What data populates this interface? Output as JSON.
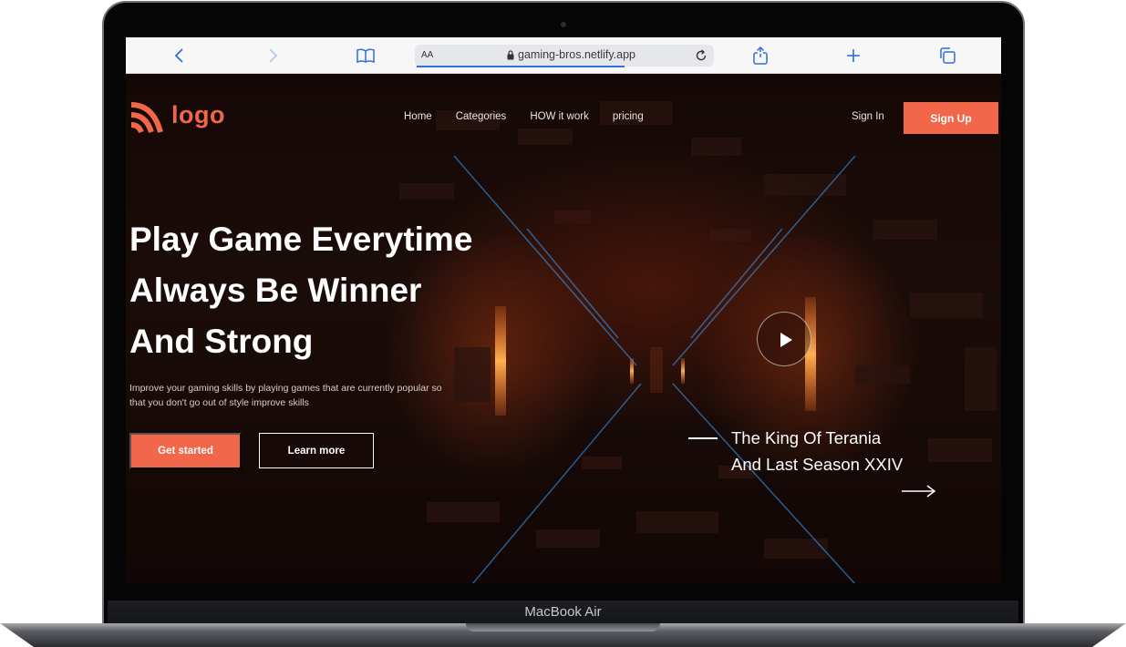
{
  "device": {
    "label": "MacBook Air"
  },
  "browser": {
    "text_size_label": "AA",
    "url": "gaming-bros.netlify.app",
    "icons": [
      "back-icon",
      "forward-icon",
      "bookmarks-icon",
      "lock-icon",
      "reload-icon",
      "share-icon",
      "new-tab-icon",
      "tabs-icon"
    ]
  },
  "site": {
    "logo_text": "logo",
    "nav": {
      "home": "Home",
      "categories": "Categories",
      "how_it_work": "HOW it work",
      "pricing": "pricing"
    },
    "sign_in": "Sign In",
    "sign_up": "Sign Up",
    "hero": {
      "line1": "Play Game Everytime",
      "line2": "Always Be Winner",
      "line3": "And Strong",
      "description": "Improve your gaming skills by playing games that are currently popular so that you don't go out of style improve skills",
      "cta_primary": "Get started",
      "cta_secondary": "Learn more"
    },
    "feature": {
      "title": "The King Of Terania And Last Season XXIV"
    }
  },
  "colors": {
    "accent": "#f2664a",
    "browser_accent": "#2f6fde",
    "background": "#140807",
    "text": "#ffffff"
  }
}
